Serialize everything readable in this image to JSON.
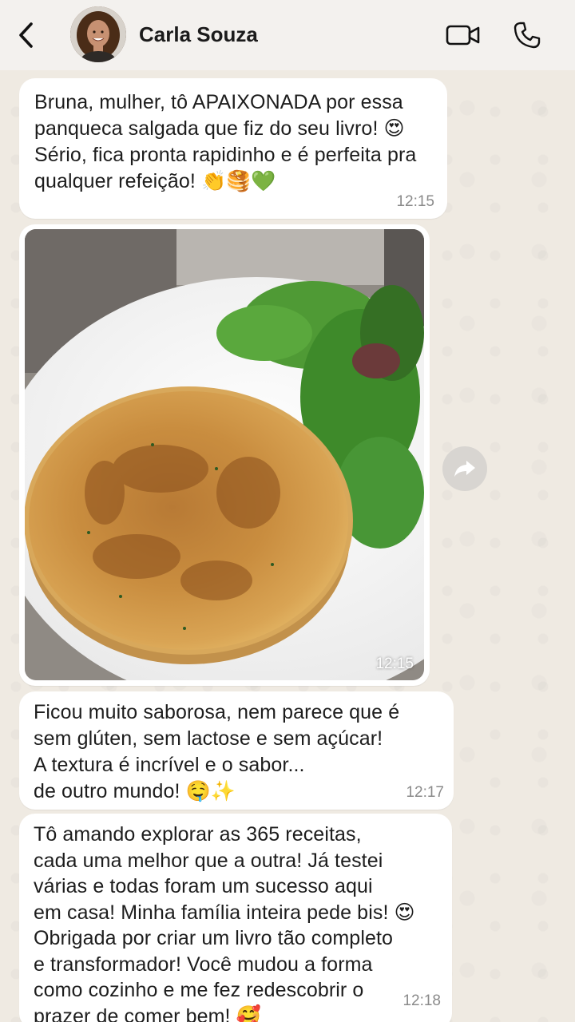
{
  "header": {
    "contact_name": "Carla Souza",
    "back_icon": "chevron-left-icon",
    "video_icon": "video-camera-icon",
    "call_icon": "phone-icon"
  },
  "messages": [
    {
      "type": "text",
      "text": "Bruna, mulher, tô APAIXONADA por essa\npanqueca salgada que fiz do seu livro! 😍\nSério, fica pronta rapidinho e é perfeita pra\nqualquer refeição! 👏🥞💚",
      "time": "12:15"
    },
    {
      "type": "image",
      "image_description_icon": "pancake-photo",
      "time": "12:15"
    },
    {
      "type": "text",
      "text": "Ficou muito saborosa, nem parece que é\nsem glúten, sem lactose e sem açúcar!\nA textura é incrível e o sabor...\nde outro mundo! 🤤✨",
      "time": "12:17"
    },
    {
      "type": "text",
      "text": "Tô amando explorar as 365 receitas,\ncada uma melhor que a outra! Já testei\nvárias e todas foram um sucesso aqui\nem casa! Minha família inteira pede bis! 😍\nObrigada por criar um livro tão completo\ne transformador! Você mudou a forma\ncomo cozinho e me fez redescobrir o\nprazer de comer bem! 🥰",
      "time": "12:18"
    }
  ],
  "colors": {
    "background": "#efeae2",
    "bubble": "#ffffff",
    "header": "#f3f1ee",
    "timestamp": "#8a8a8a"
  }
}
